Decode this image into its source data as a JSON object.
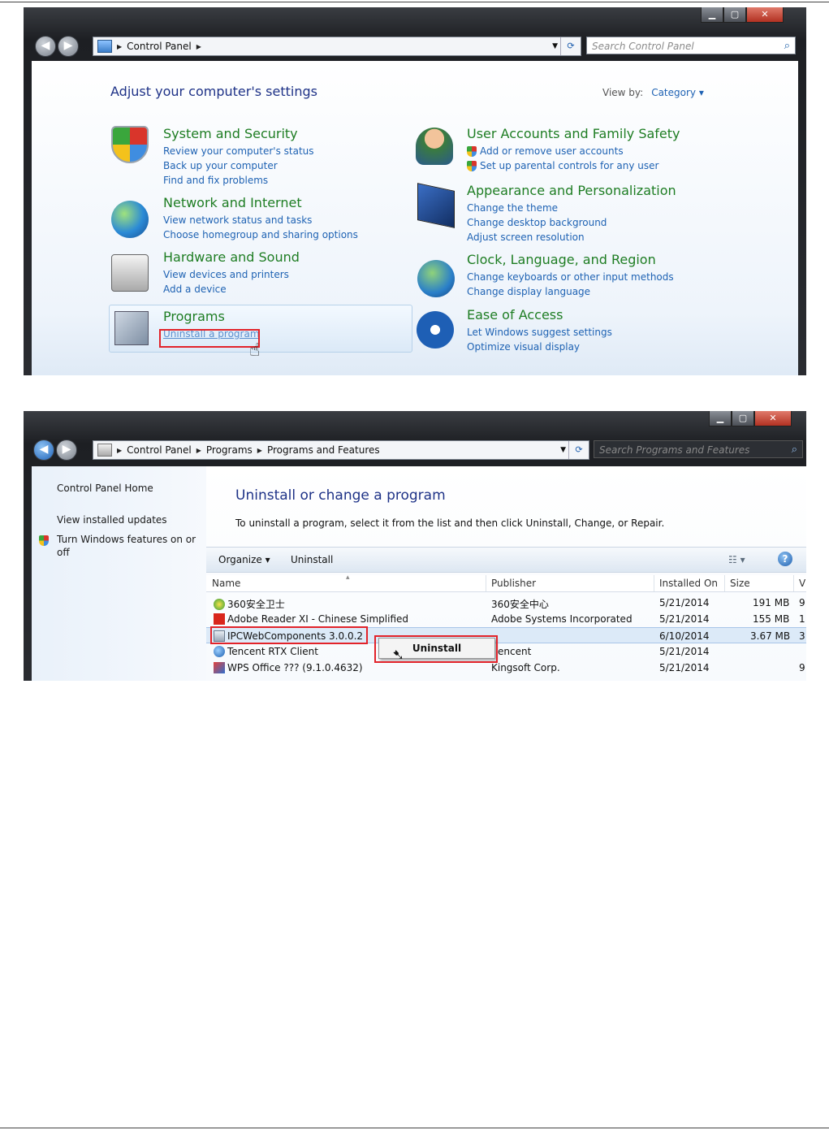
{
  "window1": {
    "address": {
      "crumbs": [
        "Control Panel"
      ]
    },
    "search_placeholder": "Search Control Panel",
    "heading": "Adjust your computer's settings",
    "view_by_label": "View by:",
    "view_by_value": "Category",
    "categories": [
      {
        "title": "System and Security",
        "links": [
          "Review your computer's status",
          "Back up your computer",
          "Find and fix problems"
        ]
      },
      {
        "title": "Network and Internet",
        "links": [
          "View network status and tasks",
          "Choose homegroup and sharing options"
        ]
      },
      {
        "title": "Hardware and Sound",
        "links": [
          "View devices and printers",
          "Add a device"
        ]
      },
      {
        "title": "Programs",
        "links": [
          "Uninstall a program"
        ]
      },
      {
        "title": "User Accounts and Family Safety",
        "links": [
          "Add or remove user accounts",
          "Set up parental controls for any user"
        ]
      },
      {
        "title": "Appearance and Personalization",
        "links": [
          "Change the theme",
          "Change desktop background",
          "Adjust screen resolution"
        ]
      },
      {
        "title": "Clock, Language, and Region",
        "links": [
          "Change keyboards or other input methods",
          "Change display language"
        ]
      },
      {
        "title": "Ease of Access",
        "links": [
          "Let Windows suggest settings",
          "Optimize visual display"
        ]
      }
    ]
  },
  "window2": {
    "address": {
      "crumbs": [
        "Control Panel",
        "Programs",
        "Programs and Features"
      ]
    },
    "search_placeholder": "Search Programs and Features",
    "sidebar": [
      "Control Panel Home",
      "View installed updates",
      "Turn Windows features on or",
      "off"
    ],
    "title": "Uninstall or change a program",
    "description": "To uninstall a program, select it from the list and then click Uninstall, Change, or Repair.",
    "toolbar": {
      "organize": "Organize",
      "uninstall": "Uninstall",
      "help": "?"
    },
    "columns": [
      "Name",
      "Publisher",
      "Installed On",
      "Size",
      "V"
    ],
    "rows": [
      {
        "name": "360安全卫士",
        "publisher": "360安全中心",
        "installed": "5/21/2014",
        "size": "191 MB",
        "v": "9"
      },
      {
        "name": "Adobe Reader XI - Chinese Simplified",
        "publisher": "Adobe Systems Incorporated",
        "installed": "5/21/2014",
        "size": "155 MB",
        "v": "1"
      },
      {
        "name": "IPCWebComponents 3.0.0.2",
        "publisher": "",
        "installed": "6/10/2014",
        "size": "3.67 MB",
        "v": "3"
      },
      {
        "name": "Tencent RTX Client",
        "publisher": "encent",
        "installed": "5/21/2014",
        "size": "",
        "v": ""
      },
      {
        "name": "WPS Office ??? (9.1.0.4632)",
        "publisher": "Kingsoft Corp.",
        "installed": "5/21/2014",
        "size": "",
        "v": "9"
      }
    ],
    "context_menu": {
      "uninstall": "Uninstall"
    }
  },
  "colors": {
    "link_blue": "#1e62b3",
    "category_green": "#1e7d23",
    "heading_navy": "#1e3287",
    "highlight_red": "#e2232a"
  }
}
